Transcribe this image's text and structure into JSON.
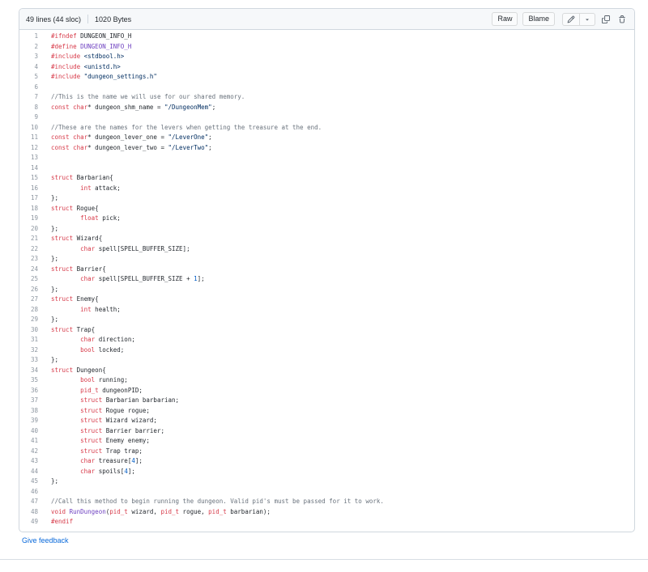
{
  "header": {
    "lines_info": "49 lines (44 sloc)",
    "size_info": "1020 Bytes",
    "raw_label": "Raw",
    "blame_label": "Blame"
  },
  "footer": {
    "feedback_label": "Give feedback"
  },
  "icons": {
    "edit": "pencil-icon",
    "edit_dropdown": "triangle-down-icon",
    "copy": "copy-icon",
    "delete": "trash-icon"
  },
  "colors": {
    "keyword": "#d73a49",
    "string": "#032f62",
    "comment": "#6a737d",
    "plain": "#24292f",
    "entity": "#6f42c1",
    "constant": "#005cc5",
    "link": "#0969da",
    "line_number": "#8c959f",
    "header_bg": "#f6f8fa",
    "border": "#d0d7de"
  },
  "code": {
    "language": "c",
    "line_count": 49,
    "lines": [
      [
        [
          "k",
          "#ifndef"
        ],
        [
          "n",
          " DUNGEON_INFO_H"
        ]
      ],
      [
        [
          "k",
          "#define"
        ],
        [
          "n",
          " "
        ],
        [
          "e",
          "DUNGEON_INFO_H"
        ]
      ],
      [
        [
          "k",
          "#include"
        ],
        [
          "n",
          " "
        ],
        [
          "s",
          "<stdbool.h>"
        ]
      ],
      [
        [
          "k",
          "#include"
        ],
        [
          "n",
          " "
        ],
        [
          "s",
          "<unistd.h>"
        ]
      ],
      [
        [
          "k",
          "#include"
        ],
        [
          "n",
          " "
        ],
        [
          "s",
          "\"dungeon_settings.h\""
        ]
      ],
      [],
      [
        [
          "c",
          "//This is the name we will use for our shared memory."
        ]
      ],
      [
        [
          "k",
          "const"
        ],
        [
          "n",
          " "
        ],
        [
          "k",
          "char"
        ],
        [
          "n",
          "* dungeon_shm_name = "
        ],
        [
          "s",
          "\"/DungeonMem\""
        ],
        [
          "n",
          ";"
        ]
      ],
      [],
      [
        [
          "c",
          "//These are the names for the levers when getting the treasure at the end."
        ]
      ],
      [
        [
          "k",
          "const"
        ],
        [
          "n",
          " "
        ],
        [
          "k",
          "char"
        ],
        [
          "n",
          "* dungeon_lever_one = "
        ],
        [
          "s",
          "\"/LeverOne\""
        ],
        [
          "n",
          ";"
        ]
      ],
      [
        [
          "k",
          "const"
        ],
        [
          "n",
          " "
        ],
        [
          "k",
          "char"
        ],
        [
          "n",
          "* dungeon_lever_two = "
        ],
        [
          "s",
          "\"/LeverTwo\""
        ],
        [
          "n",
          ";"
        ]
      ],
      [],
      [],
      [
        [
          "k",
          "struct"
        ],
        [
          "n",
          " Barbarian{"
        ]
      ],
      [
        [
          "n",
          "        "
        ],
        [
          "k",
          "int"
        ],
        [
          "n",
          " attack;"
        ]
      ],
      [
        [
          "n",
          "};"
        ]
      ],
      [
        [
          "k",
          "struct"
        ],
        [
          "n",
          " Rogue{"
        ]
      ],
      [
        [
          "n",
          "        "
        ],
        [
          "k",
          "float"
        ],
        [
          "n",
          " pick;"
        ]
      ],
      [
        [
          "n",
          "};"
        ]
      ],
      [
        [
          "k",
          "struct"
        ],
        [
          "n",
          " Wizard{"
        ]
      ],
      [
        [
          "n",
          "        "
        ],
        [
          "k",
          "char"
        ],
        [
          "n",
          " spell[SPELL_BUFFER_SIZE];"
        ]
      ],
      [
        [
          "n",
          "};"
        ]
      ],
      [
        [
          "k",
          "struct"
        ],
        [
          "n",
          " Barrier{"
        ]
      ],
      [
        [
          "n",
          "        "
        ],
        [
          "k",
          "char"
        ],
        [
          "n",
          " spell[SPELL_BUFFER_SIZE + "
        ],
        [
          "d",
          "1"
        ],
        [
          "n",
          "];"
        ]
      ],
      [
        [
          "n",
          "};"
        ]
      ],
      [
        [
          "k",
          "struct"
        ],
        [
          "n",
          " Enemy{"
        ]
      ],
      [
        [
          "n",
          "        "
        ],
        [
          "k",
          "int"
        ],
        [
          "n",
          " health;"
        ]
      ],
      [
        [
          "n",
          "};"
        ]
      ],
      [
        [
          "k",
          "struct"
        ],
        [
          "n",
          " Trap{"
        ]
      ],
      [
        [
          "n",
          "        "
        ],
        [
          "k",
          "char"
        ],
        [
          "n",
          " direction;"
        ]
      ],
      [
        [
          "n",
          "        "
        ],
        [
          "k",
          "bool"
        ],
        [
          "n",
          " locked;"
        ]
      ],
      [
        [
          "n",
          "};"
        ]
      ],
      [
        [
          "k",
          "struct"
        ],
        [
          "n",
          " Dungeon{"
        ]
      ],
      [
        [
          "n",
          "        "
        ],
        [
          "k",
          "bool"
        ],
        [
          "n",
          " running;"
        ]
      ],
      [
        [
          "n",
          "        "
        ],
        [
          "k",
          "pid_t"
        ],
        [
          "n",
          " dungeonPID;"
        ]
      ],
      [
        [
          "n",
          "        "
        ],
        [
          "k",
          "struct"
        ],
        [
          "n",
          " Barbarian barbarian;"
        ]
      ],
      [
        [
          "n",
          "        "
        ],
        [
          "k",
          "struct"
        ],
        [
          "n",
          " Rogue rogue;"
        ]
      ],
      [
        [
          "n",
          "        "
        ],
        [
          "k",
          "struct"
        ],
        [
          "n",
          " Wizard wizard;"
        ]
      ],
      [
        [
          "n",
          "        "
        ],
        [
          "k",
          "struct"
        ],
        [
          "n",
          " Barrier barrier;"
        ]
      ],
      [
        [
          "n",
          "        "
        ],
        [
          "k",
          "struct"
        ],
        [
          "n",
          " Enemy enemy;"
        ]
      ],
      [
        [
          "n",
          "        "
        ],
        [
          "k",
          "struct"
        ],
        [
          "n",
          " Trap trap;"
        ]
      ],
      [
        [
          "n",
          "        "
        ],
        [
          "k",
          "char"
        ],
        [
          "n",
          " treasure["
        ],
        [
          "d",
          "4"
        ],
        [
          "n",
          "];"
        ]
      ],
      [
        [
          "n",
          "        "
        ],
        [
          "k",
          "char"
        ],
        [
          "n",
          " spoils["
        ],
        [
          "d",
          "4"
        ],
        [
          "n",
          "];"
        ]
      ],
      [
        [
          "n",
          "};"
        ]
      ],
      [],
      [
        [
          "c",
          "//Call this method to begin running the dungeon. Valid pid's must be passed for it to work."
        ]
      ],
      [
        [
          "k",
          "void"
        ],
        [
          "n",
          " "
        ],
        [
          "e",
          "RunDungeon"
        ],
        [
          "n",
          "("
        ],
        [
          "k",
          "pid_t"
        ],
        [
          "n",
          " wizard, "
        ],
        [
          "k",
          "pid_t"
        ],
        [
          "n",
          " rogue, "
        ],
        [
          "k",
          "pid_t"
        ],
        [
          "n",
          " barbarian);"
        ]
      ],
      [
        [
          "k",
          "#endif"
        ]
      ]
    ]
  }
}
